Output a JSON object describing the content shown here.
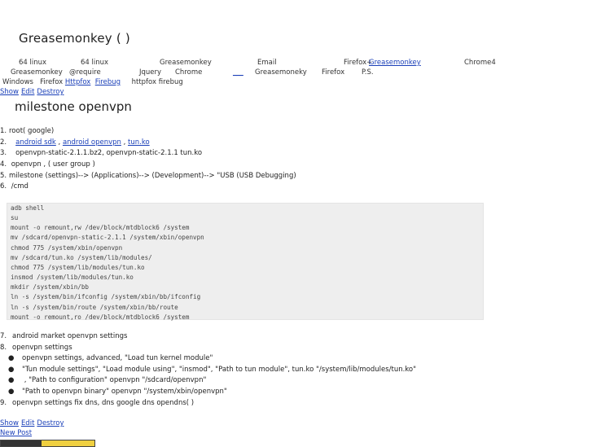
{
  "post": {
    "title": "Greasemonkey  (      )",
    "info": {
      "line1": [
        {
          "text": "64 linux"
        },
        {
          "text": "64 linux"
        },
        {
          "text": "Greasemonkey"
        },
        {
          "text": "Email"
        },
        {
          "text": "Firefox+"
        },
        {
          "text": "Greasemonkey",
          "link": true
        },
        {
          "text": "Chrome4"
        }
      ],
      "line2": [
        {
          "text": "Greasemonkey"
        },
        {
          "text": "@require"
        },
        {
          "text": "Jquery"
        },
        {
          "text": "Chrome"
        },
        {
          "text": "___",
          "link": true
        },
        {
          "text": "Greasemoneky"
        },
        {
          "text": "Firefox"
        },
        {
          "text": "P.S."
        }
      ],
      "line3": {
        "windows": "Windows",
        "firefox": "Firefox",
        "link1": "Httpfox",
        "link2": "Firebug",
        "tail": "httpfox firebug"
      }
    },
    "actions": {
      "show": "Show",
      "edit": "Edit",
      "destroy": "Destroy"
    }
  },
  "article": {
    "heading": "milestone   openvpn",
    "steps": [
      {
        "num": "1.",
        "text": "root(  google)"
      },
      {
        "num": "2.",
        "link1": "android sdk",
        "sep": " , ",
        "link2": "android openvpn",
        "sep2": " , ",
        "link3": "tun.ko"
      },
      {
        "num": "3.",
        "text": "openvpn-static-2.1.1.bz2,  openvpn-static-2.1.1 tun.ko"
      },
      {
        "num": "4.",
        "text": "          openvpn   ,                  (        user group   )"
      },
      {
        "num": "5.",
        "text": "milestone   (settings)-->    (Applications)--> (Development)--> \"USB   (USB Debugging)"
      },
      {
        "num": "6.",
        "text": "     /cmd"
      }
    ],
    "code": "adb shell\nsu\nmount -o remount,rw /dev/block/mtdblock6 /system\nmv /sdcard/openvpn-static-2.1.1 /system/xbin/openvpn\nchmod 775 /system/xbin/openvpn\nmv /sdcard/tun.ko /system/lib/modules/\nchmod 775 /system/lib/modules/tun.ko\ninsmod /system/lib/modules/tun.ko\nmkdir /system/xbin/bb\nln -s /system/bin/ifconfig /system/xbin/bb/ifconfig\nln -s /system/bin/route /system/xbin/bb/route\nmount -o remount,ro /dev/block/mtdblock6 /system",
    "steps2": [
      {
        "num": "7.",
        "text": "android market  openvpn settings"
      },
      {
        "num": "8.",
        "text": "openvpn settings"
      }
    ],
    "subs": [
      "openvpn settings,      advanced,  \"Load tun kernel module\"",
      "\"Tun module settings\",  \"Load module using\",  \"insmod\",  \"Path to tun module\",  tun.ko  \"/system/lib/modules/tun.ko\"",
      "     ,  \"Path to configuration\"  openvpn       \"/sdcard/openvpn\"",
      "\"Path to openvpn binary\"  openvpn     \"/system/xbin/openvpn\""
    ],
    "step9": {
      "num": "9.",
      "text": "openvpn settings       fix dns,        dns google dns  opendns(          )"
    }
  },
  "footer": {
    "actions": {
      "show": "Show",
      "edit": "Edit",
      "destroy": "Destroy"
    },
    "new_post": "New Post"
  }
}
